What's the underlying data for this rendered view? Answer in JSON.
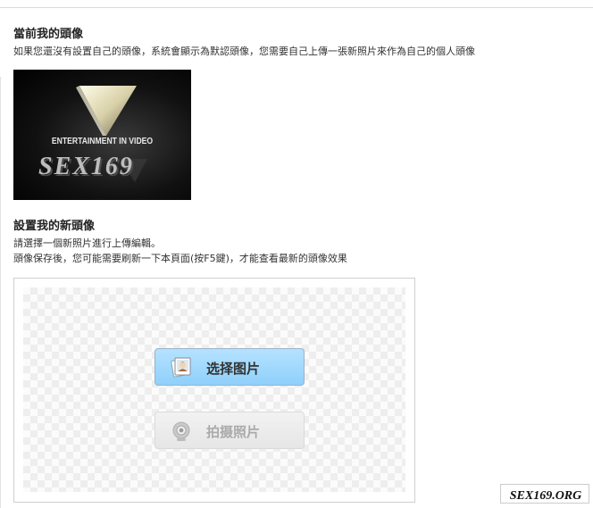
{
  "current_avatar": {
    "title": "當前我的頭像",
    "description": "如果您還沒有設置自己的頭像，系統會顯示為默認頭像，您需要自己上傳一張新照片來作為自己的個人頭像",
    "image": {
      "top_text": "ENTERTAINMENT IN VIDEO",
      "brand_text": "SEX169"
    }
  },
  "new_avatar": {
    "title": "設置我的新頭像",
    "instruction": "請選擇一個新照片進行上傳編輯。",
    "note": "頭像保存後，您可能需要刷新一下本頁面(按F5鍵)，才能查看最新的頭像效果"
  },
  "upload": {
    "select_label": "选择图片",
    "camera_label": "拍摄照片",
    "select_icon": "photo-album-icon",
    "camera_icon": "webcam-icon"
  },
  "watermark": {
    "text": "SEX169.ORG"
  }
}
